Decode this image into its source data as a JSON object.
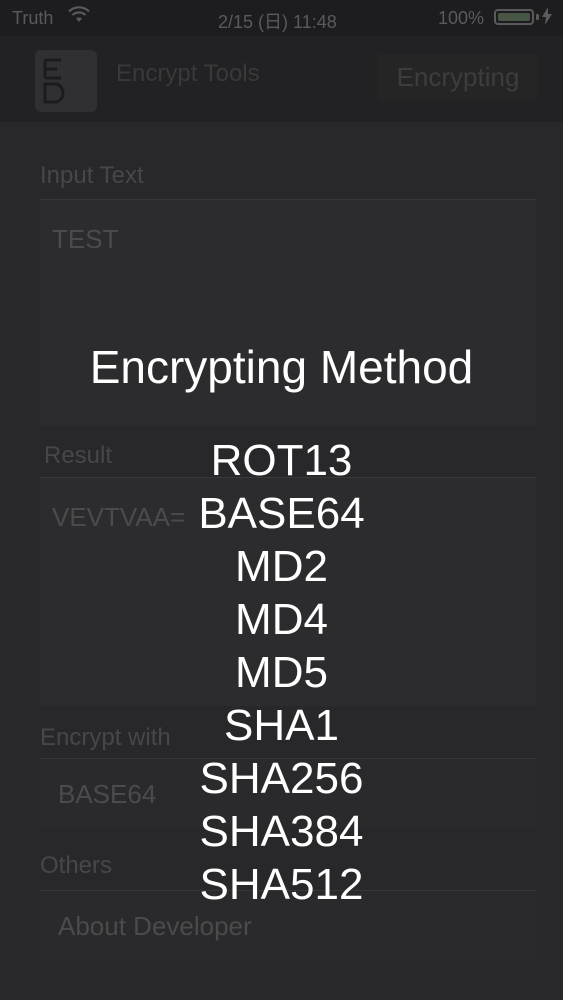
{
  "status_bar": {
    "carrier": "Truth",
    "wifi_icon": "wifi-icon",
    "time": "2/15 (日) 11:48",
    "battery_percent": "100%",
    "battery_level": 1.0,
    "charge_icon": "charging-icon"
  },
  "nav": {
    "app_icon_glyph": "E\nD",
    "title": "Encrypt Tools",
    "encrypting_button": "Encrypting"
  },
  "input": {
    "label": "Input Text",
    "value": "TEST"
  },
  "result": {
    "label": "Result",
    "value": "VEVTVAA="
  },
  "encrypt_with": {
    "label": "Encrypt with",
    "value": "BASE64"
  },
  "others": {
    "label": "Others",
    "about": "About Developer"
  },
  "method_picker": {
    "title": "Encrypting Method",
    "methods": [
      "ROT13",
      "BASE64",
      "MD2",
      "MD4",
      "MD5",
      "SHA1",
      "SHA256",
      "SHA384",
      "SHA512"
    ]
  }
}
